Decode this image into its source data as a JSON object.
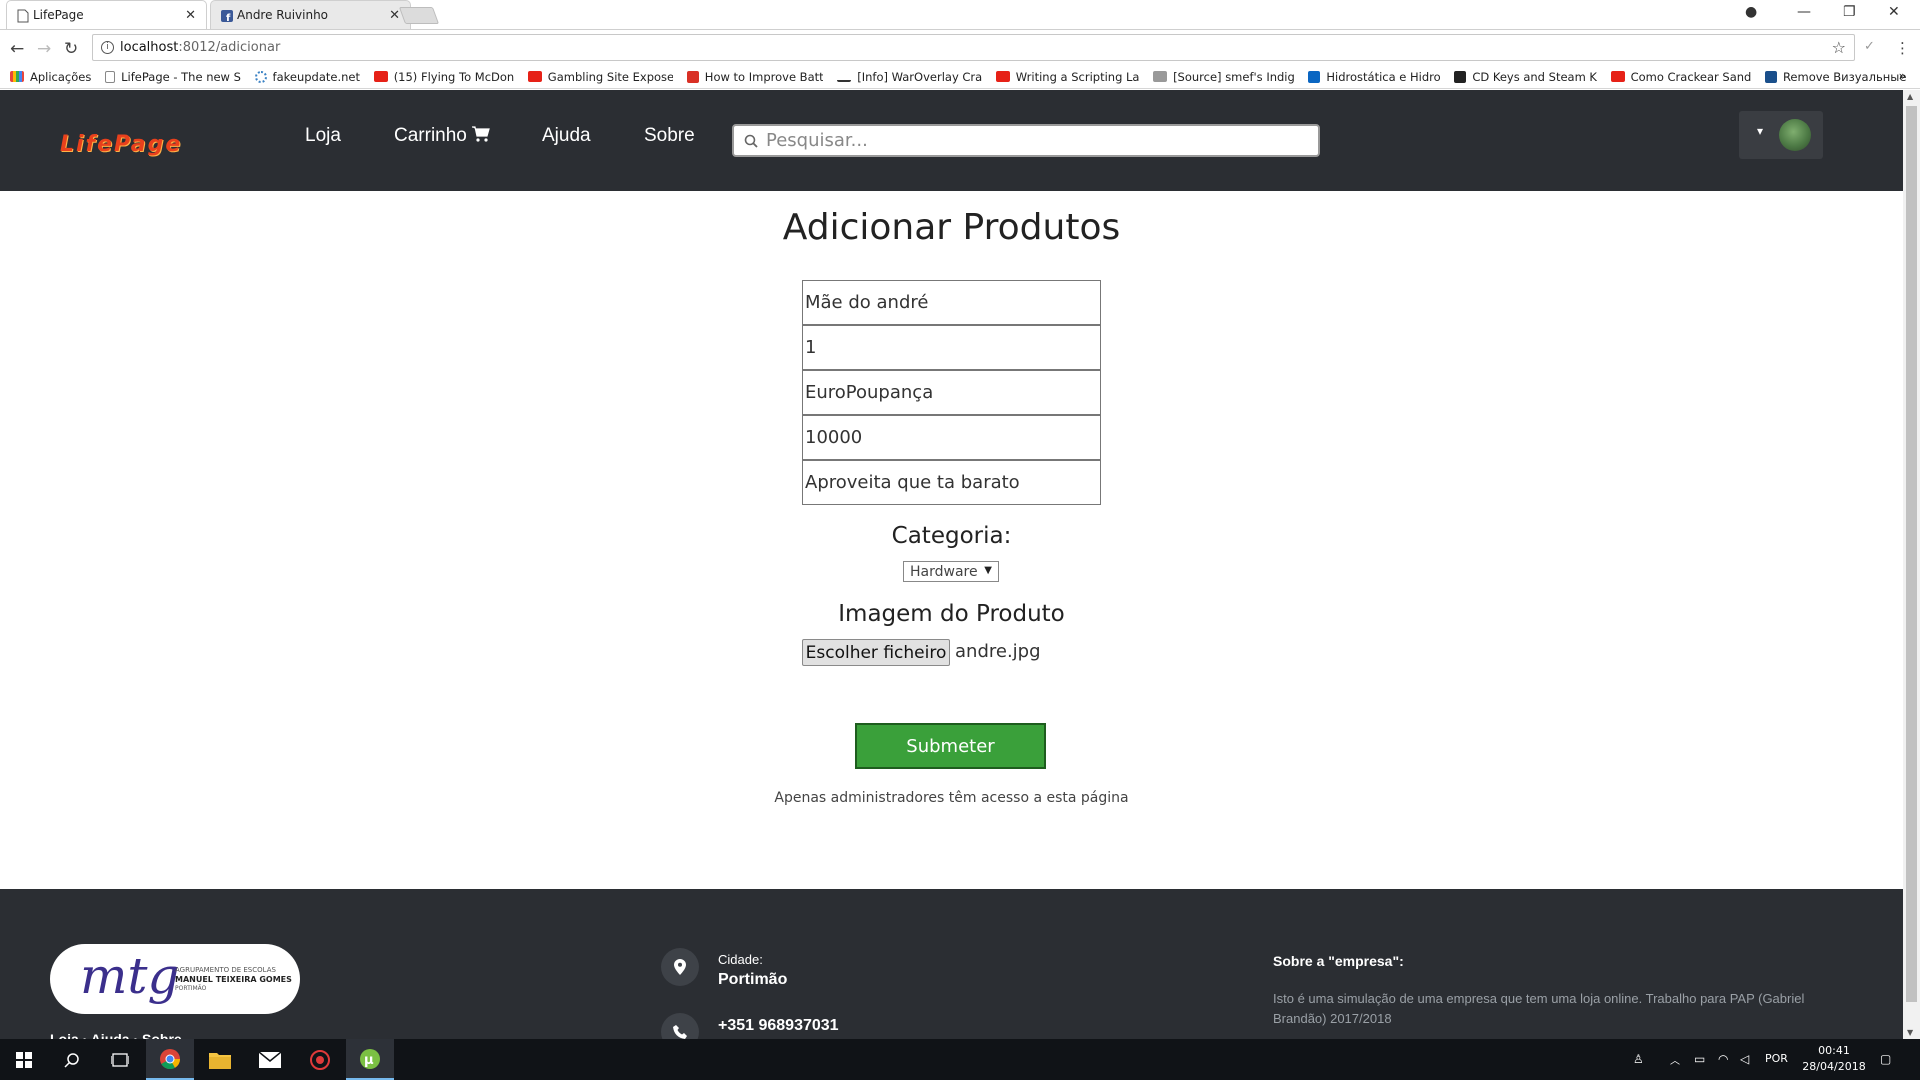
{
  "browser": {
    "tabs": [
      {
        "title": "LifePage",
        "active": true
      },
      {
        "title": "Andre Ruivinho",
        "active": false
      }
    ],
    "url_host": "localhost",
    "url_path": ":8012/adicionar",
    "bookmarks": [
      {
        "label": "Aplicações",
        "color": "#e8453c"
      },
      {
        "label": "LifePage - The new S",
        "color": "#888888"
      },
      {
        "label": "fakeupdate.net",
        "color": "#3b82c4"
      },
      {
        "label": "(15) Flying To McDon",
        "color": "#e62117"
      },
      {
        "label": "Gambling Site Expose",
        "color": "#e62117"
      },
      {
        "label": "How to Improve Batt",
        "color": "#d93025"
      },
      {
        "label": "[Info] WarOverlay Cra",
        "color": "#333333"
      },
      {
        "label": "Writing a Scripting La",
        "color": "#e62117"
      },
      {
        "label": "[Source] smef's Indig",
        "color": "#666666"
      },
      {
        "label": "Hidrostática e Hidro",
        "color": "#0a66c2"
      },
      {
        "label": "CD Keys and Steam K",
        "color": "#222222"
      },
      {
        "label": "Como Crackear Sand",
        "color": "#e62117"
      },
      {
        "label": "Remove Визуальные",
        "color": "#1a4f8b"
      }
    ]
  },
  "header": {
    "logo": "LifePage",
    "nav": [
      "Loja",
      "Carrinho",
      "Ajuda",
      "Sobre"
    ],
    "search_placeholder": "Pesquisar..."
  },
  "form": {
    "title": "Adicionar Produtos",
    "fields": [
      "Mãe do andré",
      "1",
      "EuroPoupança",
      "10000",
      "Aproveita que ta barato"
    ],
    "category_label": "Categoria:",
    "category_value": "Hardware",
    "image_label": "Imagem do Produto",
    "file_button": "Escolher ficheiro",
    "file_name": "andre.jpg",
    "submit": "Submeter",
    "admin_note": "Apenas administradores têm acesso a esta página"
  },
  "footer": {
    "logo_line1": "AGRUPAMENTO DE ESCOLAS",
    "logo_line2": "MANUEL TEIXEIRA GOMES",
    "logo_line3": "PORTIMÃO",
    "links": "Loja · Ajuda · Sobre",
    "city_label": "Cidade:",
    "city": "Portimão",
    "phone": "+351 968937031",
    "about_title": "Sobre a \"empresa\":",
    "about_text": "Isto é uma simulação de uma empresa que tem uma loja online. Trabalho para PAP (Gabriel Brandão) 2017/2018"
  },
  "taskbar": {
    "lang": "POR",
    "time": "00:41",
    "date": "28/04/2018"
  }
}
